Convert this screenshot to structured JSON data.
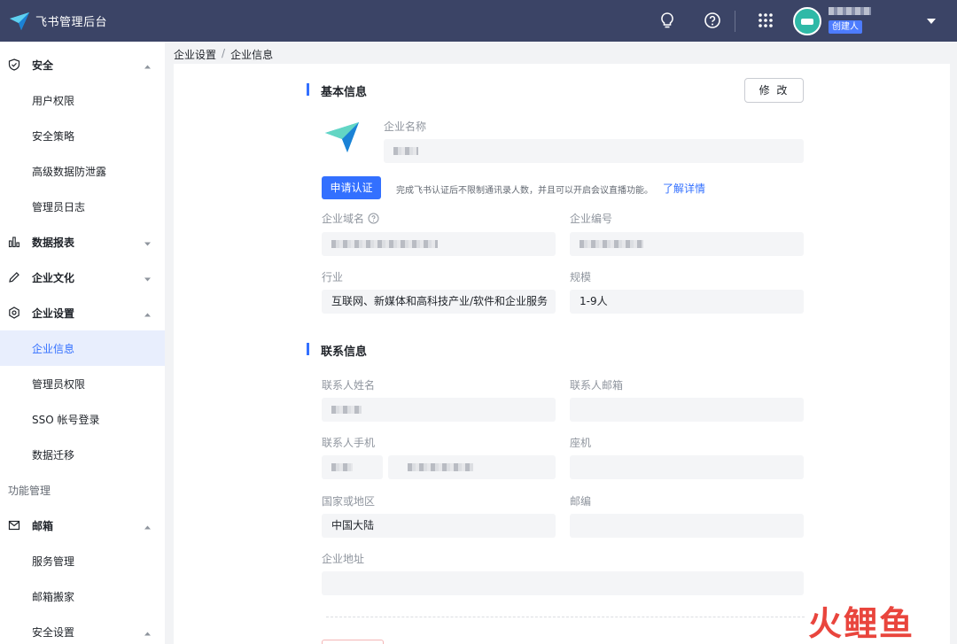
{
  "app": {
    "title": "飞书管理后台"
  },
  "user": {
    "role_badge": "创建人"
  },
  "sidebar": {
    "items": [
      {
        "label": "安全",
        "type": "group",
        "icon": "shield-icon",
        "expanded": true
      },
      {
        "label": "用户权限",
        "type": "sub"
      },
      {
        "label": "安全策略",
        "type": "sub"
      },
      {
        "label": "高级数据防泄露",
        "type": "sub"
      },
      {
        "label": "管理员日志",
        "type": "sub"
      },
      {
        "label": "数据报表",
        "type": "group",
        "icon": "bar-chart-icon",
        "expanded": false
      },
      {
        "label": "企业文化",
        "type": "group",
        "icon": "pencil-icon",
        "expanded": false
      },
      {
        "label": "企业设置",
        "type": "group",
        "icon": "settings-hex-icon",
        "expanded": true
      },
      {
        "label": "企业信息",
        "type": "sub",
        "active": true
      },
      {
        "label": "管理员权限",
        "type": "sub"
      },
      {
        "label": "SSO 帐号登录",
        "type": "sub"
      },
      {
        "label": "数据迁移",
        "type": "sub"
      },
      {
        "label": "功能管理",
        "type": "section"
      },
      {
        "label": "邮箱",
        "type": "group",
        "icon": "mail-icon",
        "expanded": true
      },
      {
        "label": "服务管理",
        "type": "sub"
      },
      {
        "label": "邮箱搬家",
        "type": "sub"
      },
      {
        "label": "安全设置",
        "type": "sub",
        "expanded": true
      }
    ]
  },
  "breadcrumb": {
    "parent": "企业设置",
    "separator": "/",
    "current": "企业信息"
  },
  "basic": {
    "title": "基本信息",
    "edit_label": "修 改",
    "company_name_label": "企业名称",
    "apply_label": "申请认证",
    "apply_tip": "完成飞书认证后不限制通讯录人数，并且可以开启会议直播功能。",
    "apply_link": "了解详情",
    "domain_label": "企业域名",
    "id_label": "企业编号",
    "industry_label": "行业",
    "industry_value": "互联网、新媒体和高科技产业/软件和企业服务",
    "scale_label": "规模",
    "scale_value": "1-9人"
  },
  "contact": {
    "title": "联系信息",
    "name_label": "联系人姓名",
    "email_label": "联系人邮箱",
    "mobile_label": "联系人手机",
    "phone_label": "座机",
    "region_label": "国家或地区",
    "region_value": "中国大陆",
    "zip_label": "邮编",
    "address_label": "企业地址"
  },
  "watermark": {
    "text": "火鲤鱼"
  },
  "colors": {
    "topbar": "#3b4466",
    "accent": "#3370ff",
    "active_bg": "#e8eefd"
  }
}
